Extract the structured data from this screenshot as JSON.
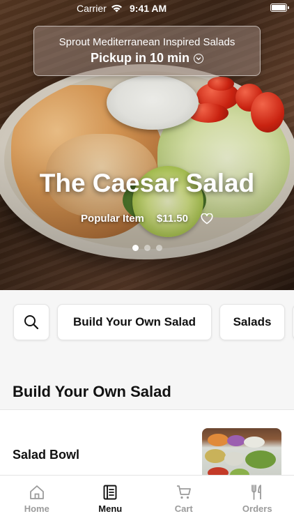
{
  "status_bar": {
    "carrier": "Carrier",
    "time": "9:41 AM"
  },
  "store": {
    "name": "Sprout Mediterranean Inspired Salads",
    "pickup": "Pickup in 10 min"
  },
  "hero": {
    "title": "The Caesar Salad",
    "tag": "Popular Item",
    "price": "$11.50",
    "slide_count": 3,
    "active_slide": 1
  },
  "categories": {
    "search_icon": "search-icon",
    "items": [
      "Build Your Own Salad",
      "Salads"
    ]
  },
  "section": {
    "title": "Build Your Own Salad"
  },
  "menu_items": [
    {
      "name": "Salad Bowl"
    }
  ],
  "tabs": [
    {
      "label": "Home",
      "icon": "home-icon"
    },
    {
      "label": "Menu",
      "icon": "menu-icon",
      "active": true
    },
    {
      "label": "Cart",
      "icon": "cart-icon"
    },
    {
      "label": "Orders",
      "icon": "orders-icon"
    }
  ],
  "colors": {
    "active_tab": "#111111",
    "inactive_tab": "#9b9b9b",
    "background": "#f6f6f6"
  }
}
